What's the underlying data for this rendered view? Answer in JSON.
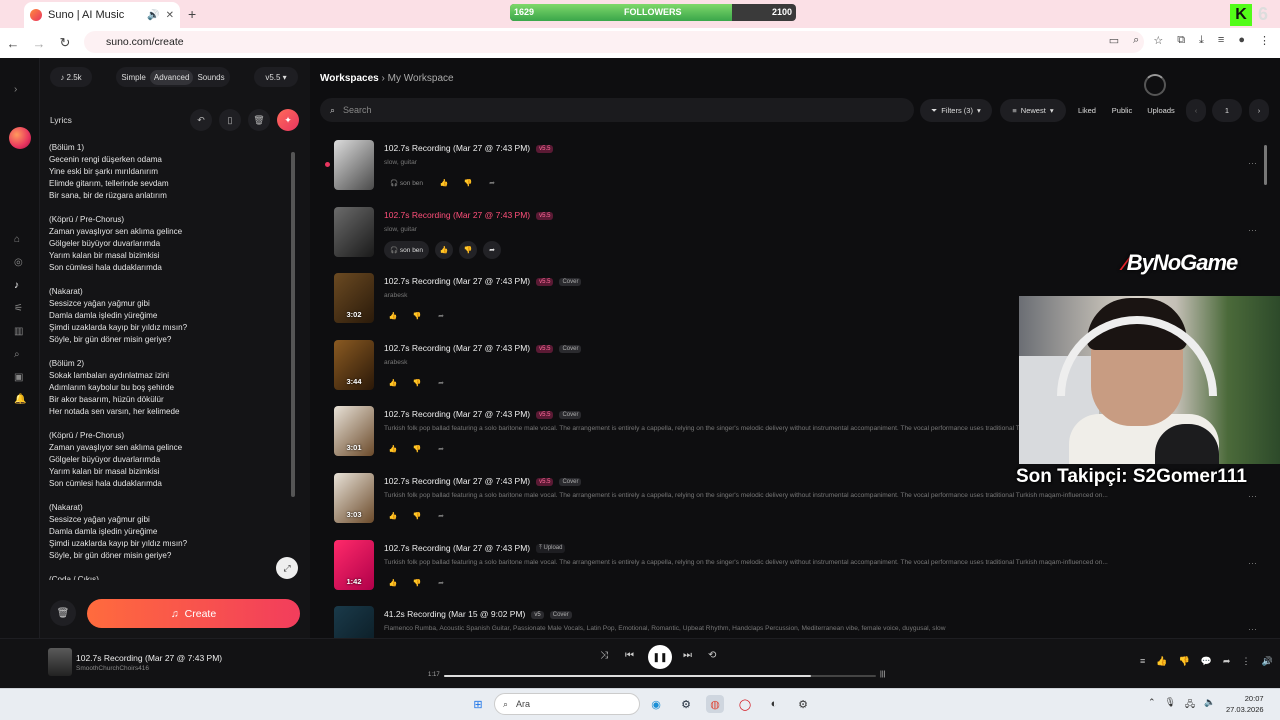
{
  "browser": {
    "tab_title": "Suno | AI Music",
    "url": "suno.com/create",
    "followers_label": "FOLLOWERS",
    "followers_current": "1629",
    "followers_goal": "2100",
    "followers_progress": 0.776,
    "kick_count": "6"
  },
  "editor": {
    "credits": "2.5k",
    "modes": [
      "Simple",
      "Advanced",
      "Sounds"
    ],
    "version": "v5.5",
    "lyrics_label": "Lyrics",
    "lyrics_text": "(Bölüm 1)\nGecenin rengi düşerken odama\nYine eski bir şarkı mırıldanırım\nElimde gitarım, tellerinde sevdam\nBir sana, bir de rüzgara anlatırım\n\n(Köprü / Pre-Chorus)\nZaman yavaşlıyor sen aklıma gelince\nGölgeler büyüyor duvarlarımda\nYarım kalan bir masal bizimkisi\nSon cümlesi hala dudaklarımda\n\n(Nakarat)\nSessizce yağan yağmur gibi\nDamla damla işledin yüreğime\nŞimdi uzaklarda kayıp bir yıldız mısın?\nSöyle, bir gün döner misin geriye?\n\n(Bölüm 2)\nSokak lambaları aydınlatmaz izini\nAdımlarım kaybolur bu boş şehirde\nBir akor basarım, hüzün dökülür\nHer notada sen varsın, her kelimede\n\n(Köprü / Pre-Chorus)\nZaman yavaşlıyor sen aklıma gelince\nGölgeler büyüyor duvarlarımda\nYarım kalan bir masal bizimkisi\nSon cümlesi hala dudaklarımda\n\n(Nakarat)\nSessizce yağan yağmur gibi\nDamla damla işledin yüreğime\nŞimdi uzaklarda kayıp bir yıldız mısın?\nSöyle, bir gün döner misin geriye?\n\n(Coda / Çıkış)",
    "create_label": "Create"
  },
  "main": {
    "breadcrumb_root": "Workspaces",
    "breadcrumb_current": "My Workspace",
    "search_placeholder": "Search",
    "filters_label": "Filters (3)",
    "sort_label": "Newest",
    "liked_label": "Liked",
    "public_label": "Public",
    "uploads_label": "Uploads",
    "page": "1"
  },
  "songs": [
    {
      "title": "102.7s Recording (Mar 27 @ 7:43 PM)",
      "badge": "v5.5",
      "tag": "",
      "desc": "slow, guitar",
      "duration": "",
      "persona": "son ben",
      "highlight": false,
      "unread": true
    },
    {
      "title": "102.7s Recording (Mar 27 @ 7:43 PM)",
      "badge": "v5.5",
      "tag": "",
      "desc": "slow, guitar",
      "duration": "",
      "persona": "son ben",
      "highlight": true,
      "unread": false
    },
    {
      "title": "102.7s Recording (Mar 27 @ 7:43 PM)",
      "badge": "v5.5",
      "tag": "Cover",
      "desc": "arabesk",
      "duration": "3:02",
      "persona": "",
      "highlight": false,
      "unread": false
    },
    {
      "title": "102.7s Recording (Mar 27 @ 7:43 PM)",
      "badge": "v5.5",
      "tag": "Cover",
      "desc": "arabesk",
      "duration": "3:44",
      "persona": "",
      "highlight": false,
      "unread": false
    },
    {
      "title": "102.7s Recording (Mar 27 @ 7:43 PM)",
      "badge": "v5.5",
      "tag": "Cover",
      "desc": "Turkish folk pop ballad featuring a solo baritone male vocal. The arrangement is entirely a cappella, relying on the singer's melodic delivery without instrumental accompaniment. The vocal performance uses traditional Turkish maqam-influenced on...",
      "duration": "3:01",
      "persona": "",
      "highlight": false,
      "unread": false
    },
    {
      "title": "102.7s Recording (Mar 27 @ 7:43 PM)",
      "badge": "v5.5",
      "tag": "Cover",
      "desc": "Turkish folk pop ballad featuring a solo baritone male vocal. The arrangement is entirely a cappella, relying on the singer's melodic delivery without instrumental accompaniment. The vocal performance uses traditional Turkish maqam-influenced on...",
      "duration": "3:03",
      "persona": "",
      "highlight": false,
      "unread": false
    },
    {
      "title": "102.7s Recording (Mar 27 @ 7:43 PM)",
      "badge": "",
      "tag": "Upload",
      "desc": "Turkish folk pop ballad featuring a solo baritone male vocal. The arrangement is entirely a cappella, relying on the singer's melodic delivery without instrumental accompaniment. The vocal performance uses traditional Turkish maqam-influenced on...",
      "duration": "1:42",
      "persona": "",
      "highlight": false,
      "unread": false
    },
    {
      "title": "41.2s Recording (Mar 15 @ 9:02 PM)",
      "badge": "v5",
      "tag": "Cover",
      "desc": "Flamenco Rumba, Acoustic Spanish Guitar, Passionate Male Vocals, Latin Pop, Emotional, Romantic, Upbeat Rhythm, Handclaps Percussion, Mediterranean vibe, female voice, duygusal, slow",
      "duration": "",
      "persona": "",
      "highlight": false,
      "unread": false
    }
  ],
  "overlay": {
    "brand": "ByNoGame",
    "follower_text": "Son Takipçi: S2Gomer111"
  },
  "player": {
    "title": "102.7s Recording (Mar 27 @ 7:43 PM)",
    "artist": "SmoothChurchChoirs416",
    "elapsed": "1:17",
    "progress": 0.85
  },
  "taskbar": {
    "search_placeholder": "Ara",
    "time": "20:07",
    "date": "27.03.2026"
  },
  "colors": {
    "accent": "#e8355f",
    "orange": "#ff6b3d",
    "bg": "#0e0e10"
  }
}
